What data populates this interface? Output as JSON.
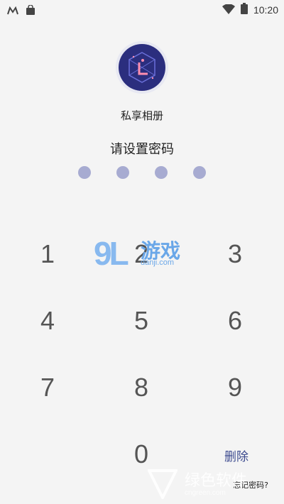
{
  "status_bar": {
    "time": "10:20"
  },
  "app": {
    "name": "私享相册"
  },
  "lock": {
    "prompt": "请设置密码",
    "pin_length": 4
  },
  "keypad": {
    "k1": "1",
    "k2": "2",
    "k3": "3",
    "k4": "4",
    "k5": "5",
    "k6": "6",
    "k7": "7",
    "k8": "8",
    "k9": "9",
    "k0": "0",
    "delete_label": "删除",
    "forgot_label": "忘记密码?"
  },
  "watermarks": {
    "top_number": "9L",
    "top_name": "游戏",
    "top_url": "danji.com",
    "bottom_name": "绿色软件",
    "bottom_url": "cngreen.com"
  },
  "colors": {
    "background": "#f4f4f4",
    "dot": "#a7abd1",
    "accent": "#3d4b8f",
    "icon_bg": "#2b2e7e"
  }
}
